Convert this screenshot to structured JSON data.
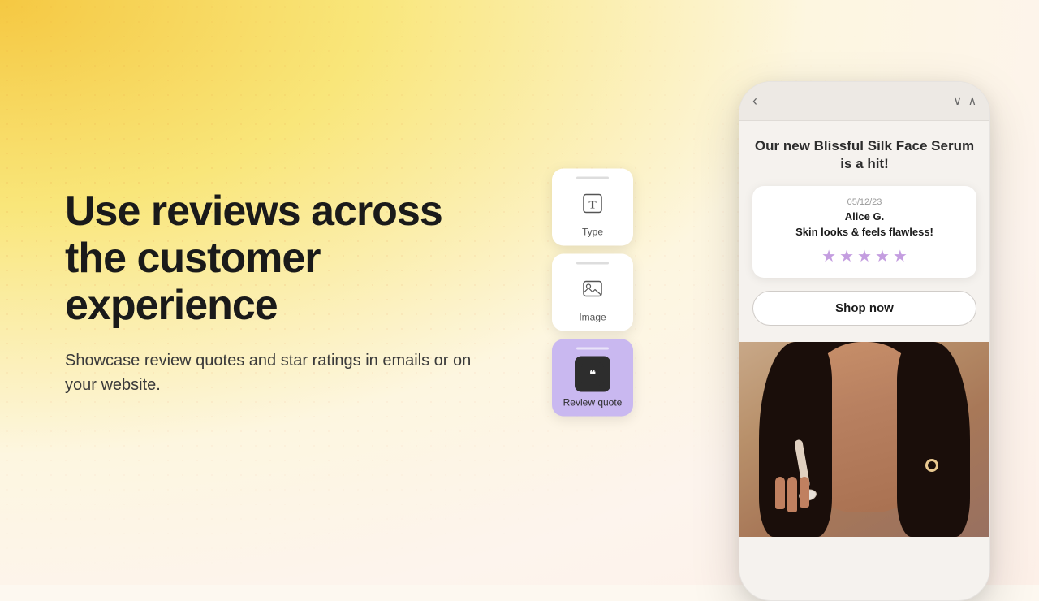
{
  "background": {
    "color_start": "#f5c842",
    "color_mid": "#fdf6e0",
    "color_end": "#fdf0e8"
  },
  "left": {
    "heading": "Use reviews across the customer experience",
    "subtext": "Showcase review quotes and star ratings in emails or on your website."
  },
  "phone": {
    "nav_back": "‹",
    "nav_up": "∧",
    "nav_down": "∨",
    "product_title": "Our new Blissful Silk Face Serum is a hit!",
    "review": {
      "date": "05/12/23",
      "author": "Alice G.",
      "text": "Skin looks & feels flawless!",
      "stars": [
        "★",
        "★",
        "★",
        "★",
        "★"
      ],
      "star_color": "#c49de0"
    },
    "shop_button": "Shop now"
  },
  "tools": [
    {
      "id": "type",
      "label": "Type",
      "icon": "T",
      "active": false
    },
    {
      "id": "image",
      "label": "Image",
      "icon": "⊞",
      "active": false
    },
    {
      "id": "review-quote",
      "label": "Review quote",
      "icon": "❝",
      "active": true
    }
  ]
}
